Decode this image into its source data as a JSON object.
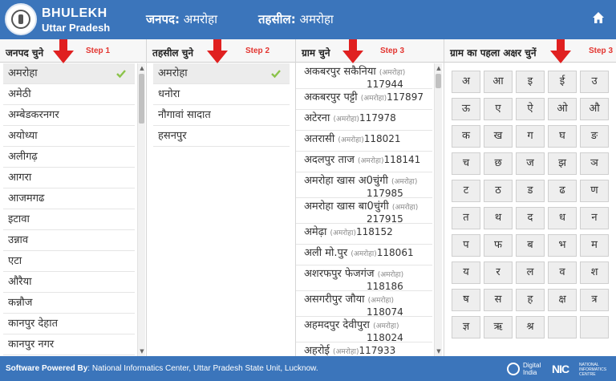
{
  "header": {
    "brand_title": "BHULEKH",
    "brand_sub": "Uttar Pradesh",
    "district_label": "जनपद:",
    "district_value": "अमरोहा",
    "tehsil_label": "तहसील:",
    "tehsil_value": "अमरोहा",
    "home_icon": "home-icon",
    "logo_icon": "emblem-logo-icon"
  },
  "district_col": {
    "title": "जनपद चुने",
    "step": "Step 1",
    "items": [
      "अमरोहा",
      "अमेठी",
      "अम्बेडकरनगर",
      "अयोध्या",
      "अलीगढ़",
      "आगरा",
      "आजमगढ",
      "इटावा",
      "उन्नाव",
      "एटा",
      "औरैया",
      "कन्नौज",
      "कानपुर देहात",
      "कानपुर नगर"
    ],
    "selected": "अमरोहा"
  },
  "tehsil_col": {
    "title": "तहसील चुने",
    "step": "Step 2",
    "items": [
      "अमरोहा",
      "धनोरा",
      "नौगावां सादात",
      "हसनपुर"
    ],
    "selected": "अमरोहा"
  },
  "village_col": {
    "title": "ग्राम चुने",
    "step": "Step 3",
    "items": [
      {
        "name": "अकबरपुर सकैनिया",
        "district": "(अमरोहा)",
        "code": "117944"
      },
      {
        "name": "अकबरपुर पट्टी",
        "district": "(अमरोहा)",
        "code": "117897"
      },
      {
        "name": "अटेरना",
        "district": "(अमरोहा)",
        "code": "117978"
      },
      {
        "name": "अतरासी",
        "district": "(अमरोहा)",
        "code": "118021"
      },
      {
        "name": "अदलपुर ताज",
        "district": "(अमरोहा)",
        "code": "118141"
      },
      {
        "name": "अमरोहा खास अ0चुंगी",
        "district": "(अमरोहा)",
        "code": "117985"
      },
      {
        "name": "अमरोहा खास बा0चुंगी",
        "district": "(अमरोहा)",
        "code": "217915"
      },
      {
        "name": "अमेढ़ा",
        "district": "(अमरोहा)",
        "code": "118152"
      },
      {
        "name": "अली मो.पुर",
        "district": "(अमरोहा)",
        "code": "118061"
      },
      {
        "name": "अशरफपुर फेजगंज",
        "district": "(अमरोहा)",
        "code": "118186"
      },
      {
        "name": "असगरीपुर जौया",
        "district": "(अमरोहा)",
        "code": "118074"
      },
      {
        "name": "अहमदपुर देवीपुरा",
        "district": "(अमरोहा)",
        "code": "118024"
      },
      {
        "name": "अहरोई",
        "district": "(अमरोहा)",
        "code": "117933"
      }
    ]
  },
  "letters_col": {
    "title": "ग्राम का पहला अक्षर चुनें",
    "step": "Step 3",
    "letters": [
      "अ",
      "आ",
      "इ",
      "ई",
      "उ",
      "ऊ",
      "ए",
      "ऐ",
      "ओ",
      "औ",
      "क",
      "ख",
      "ग",
      "घ",
      "ङ",
      "च",
      "छ",
      "ज",
      "झ",
      "ञ",
      "ट",
      "ठ",
      "ड",
      "ढ",
      "ण",
      "त",
      "थ",
      "द",
      "ध",
      "न",
      "प",
      "फ",
      "ब",
      "भ",
      "म",
      "य",
      "र",
      "ल",
      "व",
      "श",
      "ष",
      "स",
      "ह",
      "क्ष",
      "त्र",
      "ज्ञ",
      "ऋ",
      "श्र",
      "",
      ""
    ]
  },
  "footer": {
    "powered_label": "Software Powered By",
    "powered_text": ": National Informatics Center, Uttar Pradesh State Unit, Lucknow.",
    "digital_india_line1": "Digital",
    "digital_india_line2": "India",
    "nic_mark": "NIC",
    "nic_line1": "NATIONAL",
    "nic_line2": "INFORMATICS",
    "nic_line3": "CENTRE"
  },
  "colors": {
    "header_bg": "#3b75bb",
    "step_red": "#e3342f",
    "check_green": "#8bc34a",
    "arrow_red": "#e02020"
  }
}
